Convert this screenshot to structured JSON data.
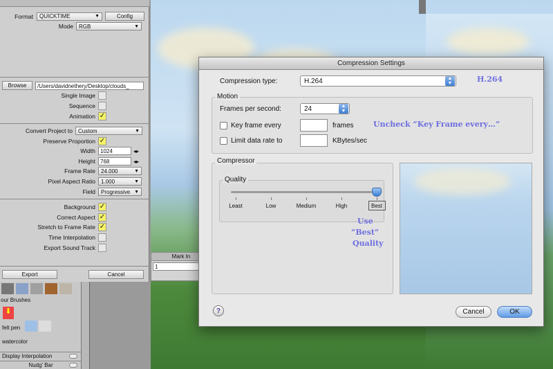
{
  "left_panel": {
    "format_label": "Format",
    "format_value": "QUICKTIME",
    "config_button": "Config",
    "mode_label": "Mode",
    "mode_value": "RGB",
    "browse_button": "Browse",
    "path_value": "/Users/davidnethery/Desktop/clouds_",
    "single_image_label": "Single Image",
    "sequence_label": "Sequence",
    "animation_label": "Animation",
    "convert_label": "Convert Project to",
    "convert_value": "Custom",
    "preserve_label": "Preserve Proportion",
    "width_label": "Width",
    "width_value": "1024",
    "height_label": "Height",
    "height_value": "768",
    "frame_rate_label": "Frame Rate",
    "frame_rate_value": "24.000",
    "pixel_aspect_label": "Pixel Aspect Ratio",
    "pixel_aspect_value": "1.000",
    "field_label": "Field",
    "field_value": "Progressive",
    "background_label": "Background",
    "correct_aspect_label": "Correct Aspect",
    "stretch_label": "Stretch to Frame Rate",
    "time_interp_label": "Time Interpolation",
    "export_sound_label": "Export Sound Track",
    "export_button": "Export",
    "cancel_button": "Cancel",
    "check_mark": "✓"
  },
  "mark_in": {
    "label": "Mark In",
    "value": "1"
  },
  "brushes": {
    "title": "our Brushes",
    "felt_pen": "felt pen",
    "watercolor": "watercolor",
    "display_interpolation": "Display Interpolation",
    "nudge_bar": "Nudg' Bar"
  },
  "dialog": {
    "title": "Compression Settings",
    "compression_type_label": "Compression type:",
    "compression_type_value": "H.264",
    "motion_label": "Motion",
    "fps_label": "Frames per second:",
    "fps_value": "24",
    "key_frame_label": "Key frame every",
    "frames_unit": "frames",
    "limit_rate_label": "Limit data rate to",
    "kbytes_unit": "KBytes/sec",
    "compressor_label": "Compressor",
    "quality_label": "Quality",
    "quality_ticks": [
      "Least",
      "Low",
      "Medium",
      "High",
      "Best"
    ],
    "quality_level_fraction": 1.0,
    "cancel_button": "Cancel",
    "ok_button": "OK",
    "help_button": "?"
  },
  "annotations": {
    "codec_note": "H.264",
    "keyframe_note": "Uncheck “Key Frame every…”",
    "quality_note_1": "Use",
    "quality_note_2": "“Best”",
    "quality_note_3": "Quality"
  },
  "colors": {
    "annotation": "#6f6fe0",
    "checkbox_on": "#f4f268",
    "ok_button": "#5f9be6"
  }
}
